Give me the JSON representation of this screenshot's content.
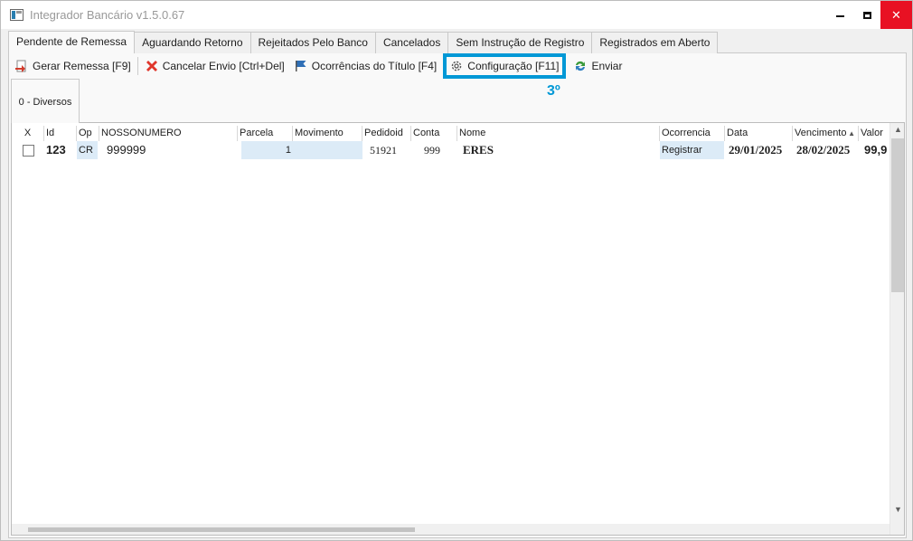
{
  "window": {
    "title": "Integrador Bancário v1.5.0.67",
    "accent_color": "#0098d6"
  },
  "tabs": [
    {
      "label": "Pendente de Remessa",
      "active": true
    },
    {
      "label": "Aguardando Retorno"
    },
    {
      "label": "Rejeitados Pelo Banco"
    },
    {
      "label": "Cancelados"
    },
    {
      "label": "Sem Instrução de Registro"
    },
    {
      "label": "Registrados em Aberto"
    }
  ],
  "toolbar": {
    "gerar": "Gerar Remessa [F9]",
    "cancelar": "Cancelar Envio [Ctrl+Del]",
    "ocorrencias": "Ocorrências do Título [F4]",
    "configuracao": "Configuração [F11]",
    "enviar": "Enviar"
  },
  "annotation": "3º",
  "subtab": "0 - Diversos",
  "grid": {
    "columns": [
      "X",
      "Id",
      "Op",
      "NOSSONUMERO",
      "Parcela",
      "Movimento",
      "Pedidoid",
      "Conta",
      "Nome",
      "Ocorrencia",
      "Data",
      "Vencimento",
      "Valor"
    ],
    "sort_indicator": "Vencimento ascending",
    "rows": [
      {
        "checked": false,
        "id": "123",
        "op": "CR",
        "nossonumero": "999999",
        "parcela": "1",
        "movimento": "",
        "pedidoid": "51921",
        "conta": "999",
        "nome": "ERES",
        "ocorrencia": "Registrar",
        "data": "29/01/2025",
        "vencimento": "28/02/2025",
        "valor": "99,9"
      }
    ]
  },
  "icons": [
    "app-icon",
    "gerar-remessa-icon",
    "cancel-x-icon",
    "flag-icon",
    "gear-icon",
    "refresh-icon",
    "sort-up-icon",
    "scroll-up-icon",
    "scroll-down-icon"
  ]
}
